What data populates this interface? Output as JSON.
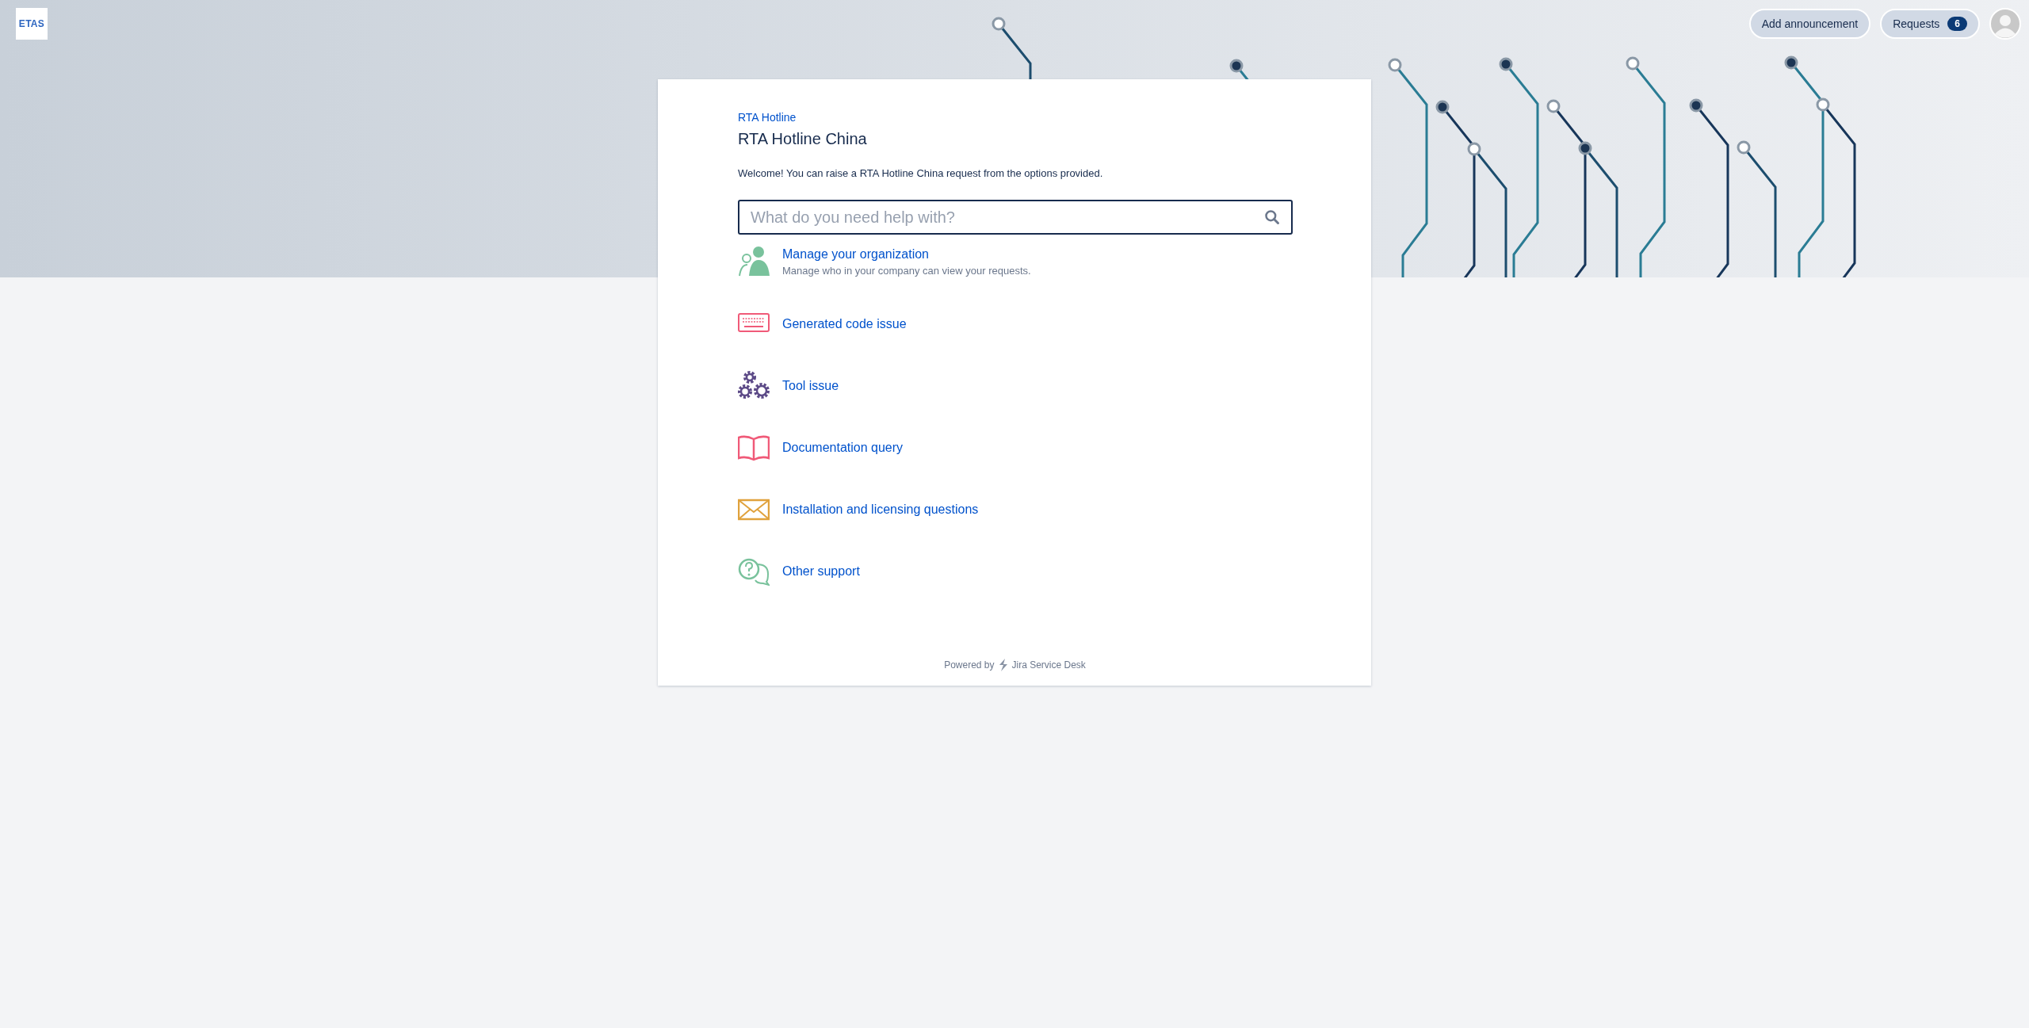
{
  "logo": {
    "text": "ETAS"
  },
  "header": {
    "buttons": [
      {
        "label": "Add announcement"
      },
      {
        "label": "Requests",
        "badge": "6"
      }
    ]
  },
  "breadcrumb": "RTA Hotline",
  "title": "RTA Hotline China",
  "welcome": "Welcome! You can raise a RTA Hotline China request from the options provided.",
  "search": {
    "placeholder": "What do you need help with?"
  },
  "request_types": [
    {
      "kind": "organization",
      "label": "Manage your organization",
      "description": "Manage who in your company can view your requests."
    },
    {
      "kind": "keyboard",
      "label": "Generated code issue"
    },
    {
      "kind": "gears",
      "label": "Tool issue"
    },
    {
      "kind": "book",
      "label": "Documentation query"
    },
    {
      "kind": "envelope",
      "label": "Installation and licensing questions"
    },
    {
      "kind": "chat",
      "label": "Other support"
    }
  ],
  "footer": {
    "powered_by": "Powered by",
    "product": "Jira Service Desk"
  }
}
